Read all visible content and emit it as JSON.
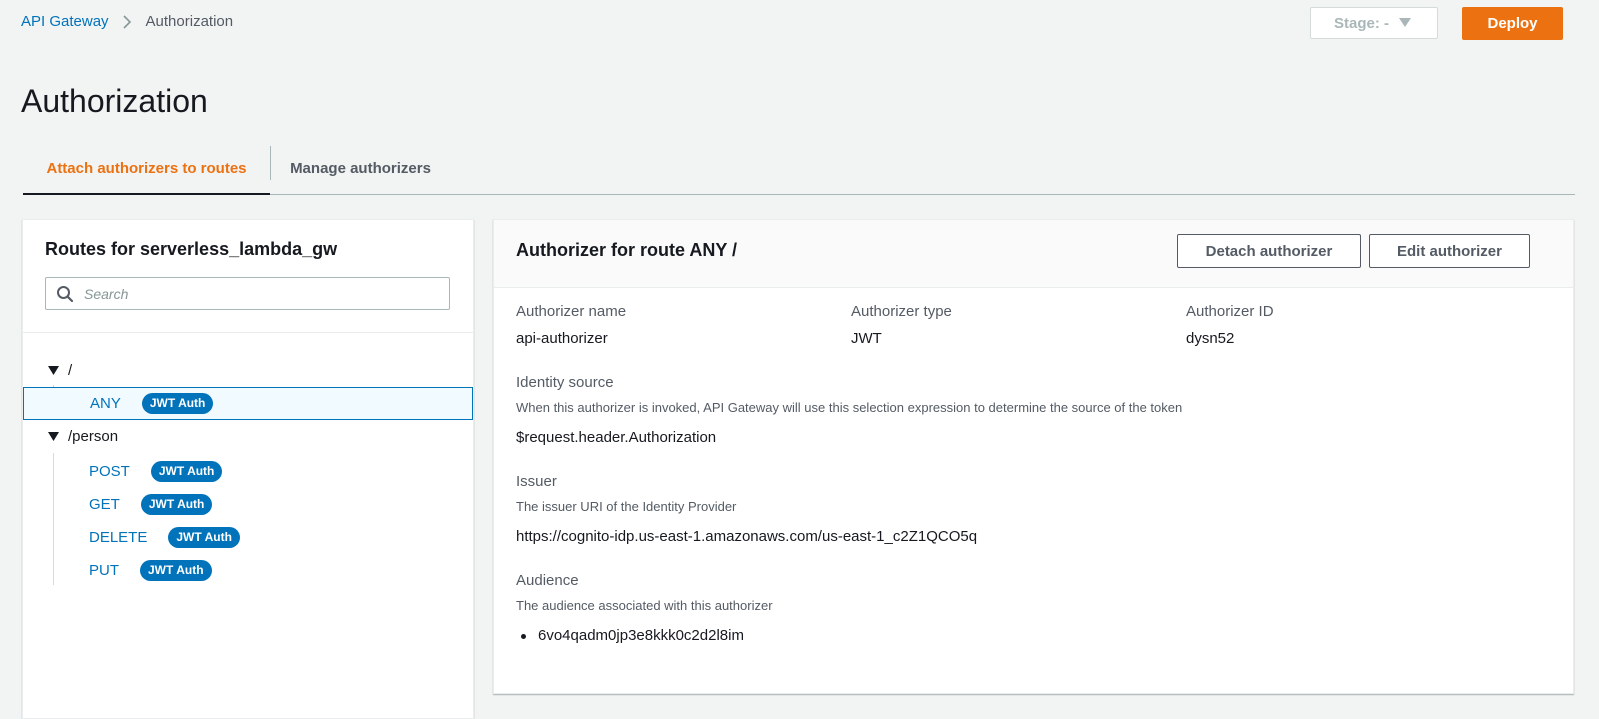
{
  "breadcrumb": {
    "root": "API Gateway",
    "current": "Authorization"
  },
  "stage": {
    "label": "Stage: -"
  },
  "deploy_label": "Deploy",
  "page_title": "Authorization",
  "tabs": [
    "Attach authorizers to routes",
    "Manage authorizers"
  ],
  "routes_panel": {
    "title": "Routes for serverless_lambda_gw",
    "search_placeholder": "Search",
    "tree": [
      {
        "path": "/",
        "routes": [
          {
            "method": "ANY",
            "badge": "JWT Auth",
            "selected": true
          }
        ]
      },
      {
        "path": "/person",
        "routes": [
          {
            "method": "POST",
            "badge": "JWT Auth"
          },
          {
            "method": "GET",
            "badge": "JWT Auth"
          },
          {
            "method": "DELETE",
            "badge": "JWT Auth"
          },
          {
            "method": "PUT",
            "badge": "JWT Auth"
          }
        ]
      }
    ]
  },
  "detail": {
    "title": "Authorizer for route ANY /",
    "detach_label": "Detach authorizer",
    "edit_label": "Edit authorizer",
    "fields": {
      "name": {
        "label": "Authorizer name",
        "value": "api-authorizer"
      },
      "type": {
        "label": "Authorizer type",
        "value": "JWT"
      },
      "id": {
        "label": "Authorizer ID",
        "value": "dysn52"
      }
    },
    "identity_source": {
      "label": "Identity source",
      "description": "When this authorizer is invoked, API Gateway will use this selection expression to determine the source of the token",
      "value": "$request.header.Authorization"
    },
    "issuer": {
      "label": "Issuer",
      "description": "The issuer URI of the Identity Provider",
      "value": "https://cognito-idp.us-east-1.amazonaws.com/us-east-1_c2Z1QCO5q"
    },
    "audience": {
      "label": "Audience",
      "description": "The audience associated with this authorizer",
      "values": [
        "6vo4qadm0jp3e8kkk0c2d2l8im"
      ]
    }
  },
  "colors": {
    "accent": "#ec7211",
    "link": "#0073bb",
    "badge": "#0073bb",
    "background": "#f2f3f3"
  },
  "icons": [
    "chevron-right-icon",
    "caret-down-icon",
    "search-icon",
    "triangle-down-icon"
  ]
}
